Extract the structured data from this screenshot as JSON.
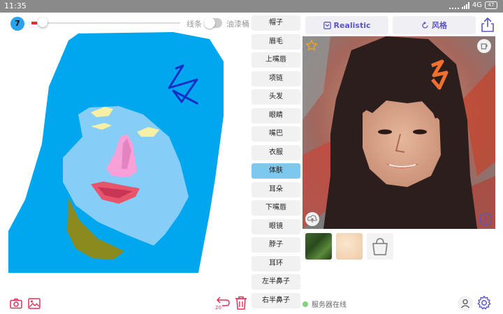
{
  "status_bar": {
    "time": "11:35",
    "network": "4G",
    "battery": "47"
  },
  "toolbar": {
    "brush_size": "7",
    "line_label": "线条",
    "bucket_label": "油漆桶",
    "line_mode_on": false
  },
  "categories": [
    {
      "label": "帽子",
      "active": false
    },
    {
      "label": "眉毛",
      "active": false
    },
    {
      "label": "上嘴唇",
      "active": false
    },
    {
      "label": "项链",
      "active": false
    },
    {
      "label": "头发",
      "active": false
    },
    {
      "label": "眼睛",
      "active": false
    },
    {
      "label": "嘴巴",
      "active": false
    },
    {
      "label": "衣服",
      "active": false
    },
    {
      "label": "体肤",
      "active": true
    },
    {
      "label": "耳朵",
      "active": false
    },
    {
      "label": "下嘴唇",
      "active": false
    },
    {
      "label": "眼镜",
      "active": false
    },
    {
      "label": "脖子",
      "active": false
    },
    {
      "label": "耳环",
      "active": false
    },
    {
      "label": "左半鼻子",
      "active": false
    },
    {
      "label": "右半鼻子",
      "active": false
    }
  ],
  "result": {
    "realistic_label": "Realistic",
    "style_label": "风格"
  },
  "footer": {
    "server_status": "服务器在线",
    "undo_count": "20"
  },
  "colors": {
    "accent": "#5b55c9",
    "pink": "#e0305a",
    "hair": "#00a6ee",
    "skin": "#86cdf7",
    "active_category": "#7cc8ef"
  },
  "icons": [
    "camera-icon",
    "image-icon",
    "undo-icon",
    "trash-icon",
    "share-icon",
    "star-icon",
    "cup-icon",
    "upload-icon",
    "info-icon",
    "user-icon",
    "gear-icon",
    "bag-icon"
  ]
}
